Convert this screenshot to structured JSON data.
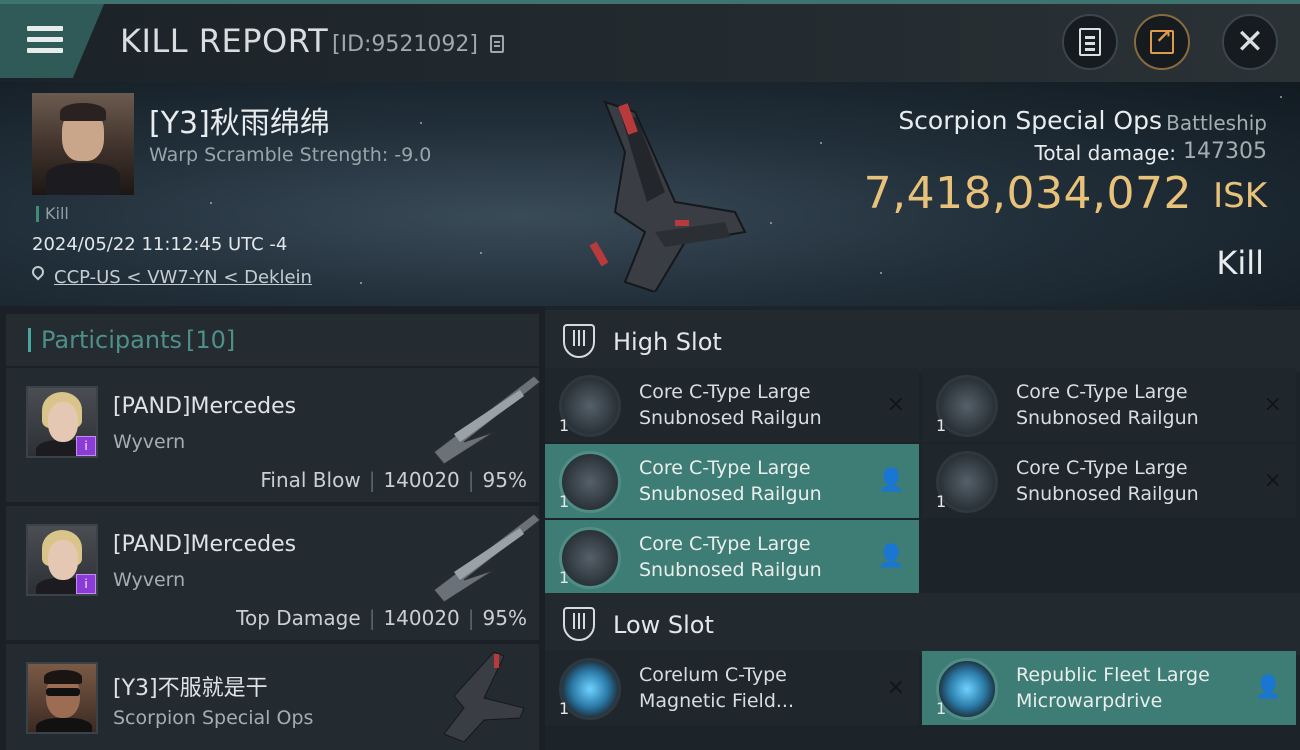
{
  "header": {
    "title": "KILL REPORT",
    "id_text": "[ID:9521092]"
  },
  "victim": {
    "name": "[Y3]秋雨绵绵",
    "warp_scramble": "Warp Scramble Strength: -9.0",
    "tag": "Kill",
    "datetime": "2024/05/22 11:12:45 UTC -4",
    "location": "CCP-US < VW7-YN < Deklein",
    "ship_name": "Scorpion Special Ops",
    "ship_class": "Battleship",
    "total_damage_label": "Total damage:",
    "total_damage": "147305",
    "isk_value": "7,418,034,072",
    "isk_unit": "ISK",
    "result": "Kill"
  },
  "participants": {
    "title": "Participants",
    "count": "[10]",
    "items": [
      {
        "name": "[PAND]Mercedes",
        "ship": "Wyvern",
        "role": "Final Blow",
        "damage": "140020",
        "percent": "95%",
        "badge": "i"
      },
      {
        "name": "[PAND]Mercedes",
        "ship": "Wyvern",
        "role": "Top Damage",
        "damage": "140020",
        "percent": "95%",
        "badge": "i"
      },
      {
        "name": "[Y3]不服就是干",
        "ship": "Scorpion Special Ops",
        "role": "",
        "damage": "",
        "percent": ""
      }
    ]
  },
  "fitting": {
    "high_slot": {
      "title": "High Slot",
      "modules": [
        {
          "name": "Core C-Type Large Snubnosed Railgun",
          "qty": "1",
          "status": "×"
        },
        {
          "name": "Core C-Type Large Snubnosed Railgun",
          "qty": "1",
          "status": "×"
        },
        {
          "name": "Core C-Type Large Snubnosed Railgun",
          "qty": "1",
          "status": "👤"
        },
        {
          "name": "Core C-Type Large Snubnosed Railgun",
          "qty": "1",
          "status": "×"
        },
        {
          "name": "Core C-Type Large Snubnosed Railgun",
          "qty": "1",
          "status": "👤"
        }
      ]
    },
    "low_slot": {
      "title": "Low Slot",
      "modules": [
        {
          "name": "Corelum C-Type Magnetic Field...",
          "qty": "1",
          "status": "×"
        },
        {
          "name": "Republic Fleet Large Microwarpdrive",
          "qty": "1",
          "status": "👤"
        }
      ]
    }
  }
}
